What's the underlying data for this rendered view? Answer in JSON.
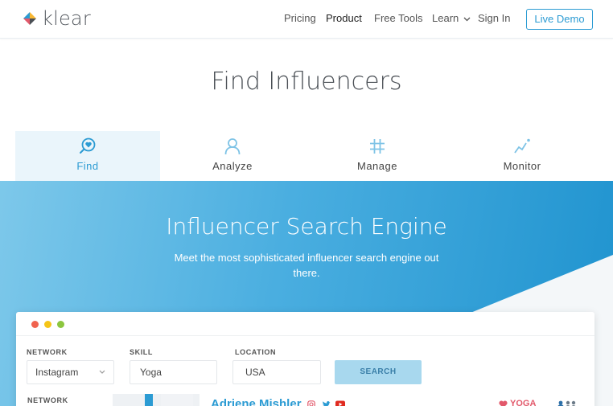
{
  "brand": {
    "name": "klear"
  },
  "nav": {
    "items": [
      {
        "label": "Pricing"
      },
      {
        "label": "Product"
      },
      {
        "label": "Free Tools"
      },
      {
        "label": "Learn"
      },
      {
        "label": "Sign In"
      }
    ],
    "cta": "Live Demo"
  },
  "page": {
    "title": "Find Influencers"
  },
  "tabs": [
    {
      "label": "Find",
      "icon": "search-heart-icon",
      "active": true
    },
    {
      "label": "Analyze",
      "icon": "person-icon",
      "active": false
    },
    {
      "label": "Manage",
      "icon": "hashtag-icon",
      "active": false
    },
    {
      "label": "Monitor",
      "icon": "trend-icon",
      "active": false
    }
  ],
  "hero": {
    "title": "Influencer Search Engine",
    "subtitle": "Meet the most sophisticated influencer search engine out there."
  },
  "search": {
    "network": {
      "label": "NETWORK",
      "value": "Instagram"
    },
    "skill": {
      "label": "SKILL",
      "value": "Yoga"
    },
    "location": {
      "label": "LOCATION",
      "value": "USA"
    },
    "button": "SEARCH",
    "filter_label": "NETWORK"
  },
  "result": {
    "name": "Adriene Mishler",
    "tag": "YOGA"
  },
  "colors": {
    "accent": "#2b9bd3",
    "hero_start": "#7dc8ea",
    "hero_end": "#1f93cf",
    "dot_red": "#f0634f",
    "dot_yellow": "#f5c518",
    "dot_green": "#8cc63f"
  }
}
